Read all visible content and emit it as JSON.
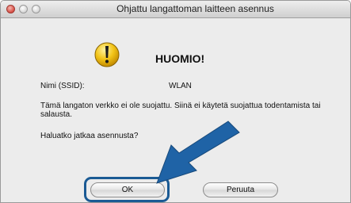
{
  "window": {
    "title": "Ohjattu langattoman laitteen asennus"
  },
  "alert": {
    "icon": "caution-icon",
    "heading": "HUOMIO!"
  },
  "details": {
    "ssid_label": "Nimi (SSID):",
    "ssid_value": "WLAN",
    "warning_text": "Tämä langaton verkko ei ole suojattu. Siinä ei käytetä suojattua todentamista tai salausta.",
    "question": "Haluatko jatkaa asennusta?"
  },
  "buttons": {
    "ok_label": "OK",
    "cancel_label": "Peruuta"
  },
  "colors": {
    "highlight": "#1a5a94",
    "arrow": "#1f63a6",
    "caution_fill": "#f2c418"
  }
}
